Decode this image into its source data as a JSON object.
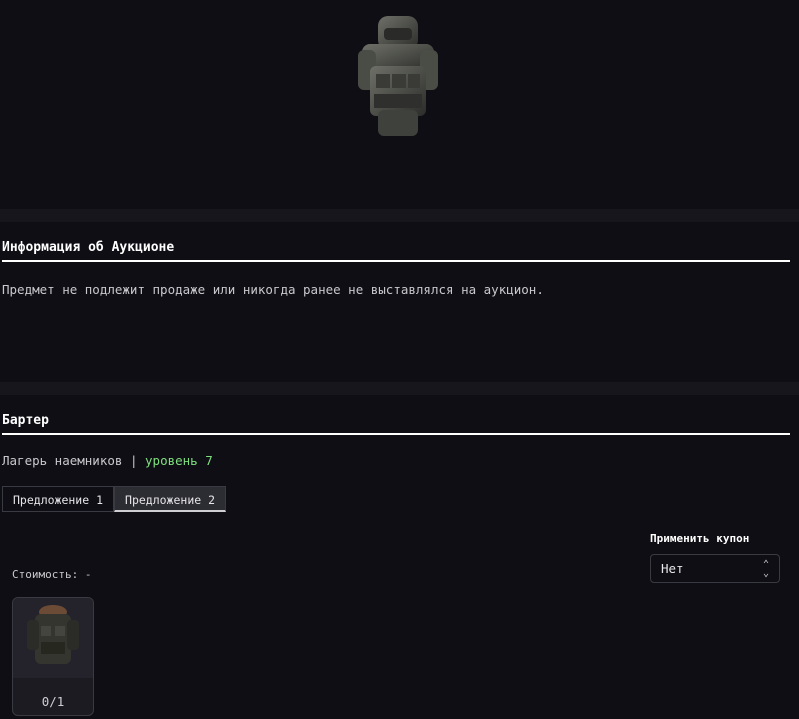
{
  "hero": {
    "icon": "armor-suit-image"
  },
  "auction": {
    "title": "Информация об Аукционе",
    "message": "Предмет не подлежит продаже или никогда ранее не выставлялся на аукцион."
  },
  "barter": {
    "title": "Бартер",
    "vendor": "Лагерь наемников",
    "separator": "|",
    "level": "уровень 7",
    "tabs": [
      {
        "label": "Предложение 1",
        "active": false
      },
      {
        "label": "Предложение 2",
        "active": true
      }
    ],
    "coupon_label": "Применить купон",
    "coupon_value": "Нет",
    "cost": "Стоимость: -",
    "items": [
      {
        "icon": "armor-vest-image",
        "count": "0/1"
      }
    ]
  },
  "colors": {
    "background": "#0f0e14",
    "level": "#7ee07e",
    "rule": "#ffffff"
  }
}
